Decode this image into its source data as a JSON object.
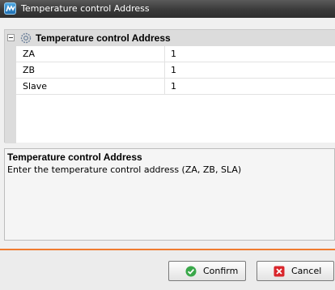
{
  "window": {
    "title": "Temperature control Address",
    "app_icon": "app-logo-icon"
  },
  "grid": {
    "category": {
      "label": "Temperature control Address",
      "icon": "gear-icon",
      "expanded": true
    },
    "properties": [
      {
        "name": "ZA",
        "value": "1"
      },
      {
        "name": "ZB",
        "value": "1"
      },
      {
        "name": "Slave",
        "value": "1"
      }
    ]
  },
  "description": {
    "title": "Temperature control Address",
    "text": "Enter the temperature control address (ZA, ZB, SLA)"
  },
  "buttons": {
    "confirm": {
      "label": "Confirm",
      "icon": "check-circle-icon"
    },
    "cancel": {
      "label": "Cancel",
      "icon": "close-box-icon"
    }
  },
  "colors": {
    "accent_separator": "#f07a2e",
    "confirm_icon": "#3aa84a",
    "cancel_icon": "#d9262c"
  }
}
